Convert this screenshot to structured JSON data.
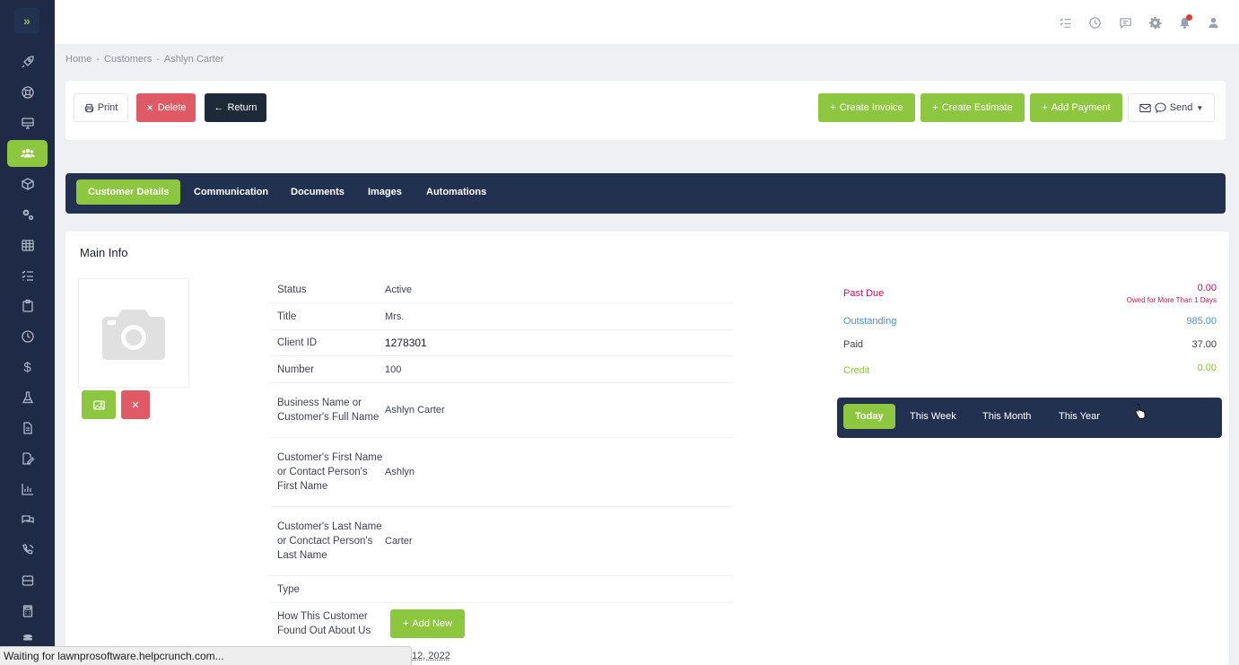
{
  "sidebar": {
    "items": [
      {
        "name": "rocket-icon",
        "active": false
      },
      {
        "name": "lifebuoy-icon",
        "active": false
      },
      {
        "name": "monitor-icon",
        "active": false
      },
      {
        "name": "customers-icon",
        "active": true
      },
      {
        "name": "box-icon",
        "active": false
      },
      {
        "name": "cogs-icon",
        "active": false
      },
      {
        "name": "calendar-icon",
        "active": false
      },
      {
        "name": "tasks-icon",
        "active": false
      },
      {
        "name": "clipboard-icon",
        "active": false
      },
      {
        "name": "clock-icon",
        "active": false
      },
      {
        "name": "dollar-icon",
        "active": false
      },
      {
        "name": "flask-icon",
        "active": false
      },
      {
        "name": "document-icon",
        "active": false
      },
      {
        "name": "signature-icon",
        "active": false
      },
      {
        "name": "chart-icon",
        "active": false
      },
      {
        "name": "comments-icon",
        "active": false
      },
      {
        "name": "phone-icon",
        "active": false
      },
      {
        "name": "database-icon",
        "active": false
      },
      {
        "name": "calculator-icon",
        "active": false
      },
      {
        "name": "stack-icon",
        "active": false
      }
    ]
  },
  "breadcrumb": [
    "Home",
    "-",
    "Customers",
    "-",
    "Ashlyn Carter"
  ],
  "actions": {
    "print": "Print",
    "delete": "Delete",
    "return": "Return",
    "create_invoice": "Create Invoice",
    "create_estimate": "Create Estimate",
    "add_payment": "Add Payment",
    "send": "Send"
  },
  "tabs": [
    "Customer Details",
    "Communication",
    "Documents",
    "Images",
    "Automations"
  ],
  "main_info": {
    "title": "Main Info",
    "rows": [
      {
        "label": "Status",
        "value": "Active"
      },
      {
        "label": "Title",
        "value": "Mrs."
      },
      {
        "label": "Client ID",
        "value": "1278301"
      },
      {
        "label": "Number",
        "value": "100"
      },
      {
        "label": "Business Name or Customer's Full Name",
        "value": "Ashlyn Carter"
      },
      {
        "label": "Customer's First Name or Contact Person's First Name",
        "value": "Ashlyn"
      },
      {
        "label": "Customer's Last Name or Conctact Person's Last Name",
        "value": "Carter"
      },
      {
        "label": "Type",
        "value": ""
      },
      {
        "label": "How This Customer Found Out About Us",
        "value": ""
      }
    ],
    "add_new": "Add New",
    "date_fragment": "12, 2022"
  },
  "balances": {
    "past_due_label": "Past Due",
    "past_due_value": "0.00",
    "past_due_note": "Owed for More Than 1 Days",
    "outstanding_label": "Outstanding",
    "outstanding_value": "985.00",
    "paid_label": "Paid",
    "paid_value": "37.00",
    "credit_label": "Credit",
    "credit_value": "0.00"
  },
  "periods": [
    "Today",
    "This Week",
    "This Month",
    "This Year"
  ],
  "status_bar": "Waiting for lawnprosoftware.helpcrunch.com...",
  "colors": {
    "sidebar": "#1e2a46",
    "accent_green": "#8dc63f",
    "danger_red": "#e05a66",
    "outstanding_blue": "#4a90d9",
    "past_due_red": "#c2185b"
  }
}
